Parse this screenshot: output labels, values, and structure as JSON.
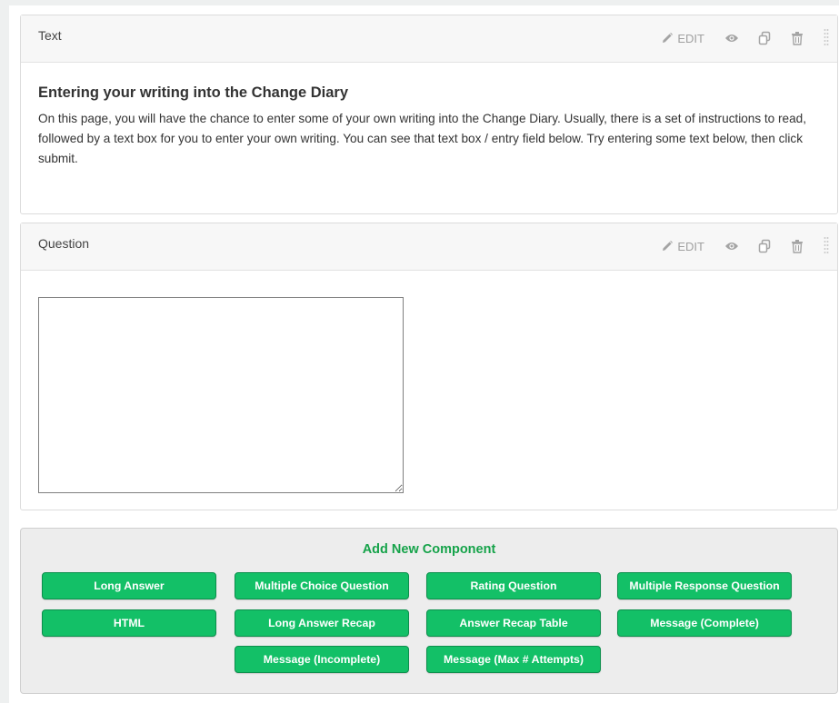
{
  "text_panel": {
    "title": "Text",
    "edit_label": "EDIT",
    "heading": "Entering your writing into the Change Diary",
    "paragraph": "On this page, you will have the chance to enter some of your own writing into the Change Diary. Usually, there is a set of instructions to read, followed by a text box for you to enter your own writing. You can see that text box / entry field below. Try entering some text below, then click submit."
  },
  "question_panel": {
    "title": "Question",
    "edit_label": "EDIT",
    "answer_value": ""
  },
  "add_component": {
    "title": "Add New Component",
    "buttons": [
      "Long Answer",
      "Multiple Choice Question",
      "Rating Question",
      "Multiple Response Question",
      "HTML",
      "Long Answer Recap",
      "Answer Recap Table",
      "Message (Complete)",
      "Message (Incomplete)",
      "Message (Max # Attempts)"
    ]
  },
  "colors": {
    "accent_green": "#13c067",
    "title_green": "#16a34a",
    "icon_grey": "#a4a4a4"
  }
}
